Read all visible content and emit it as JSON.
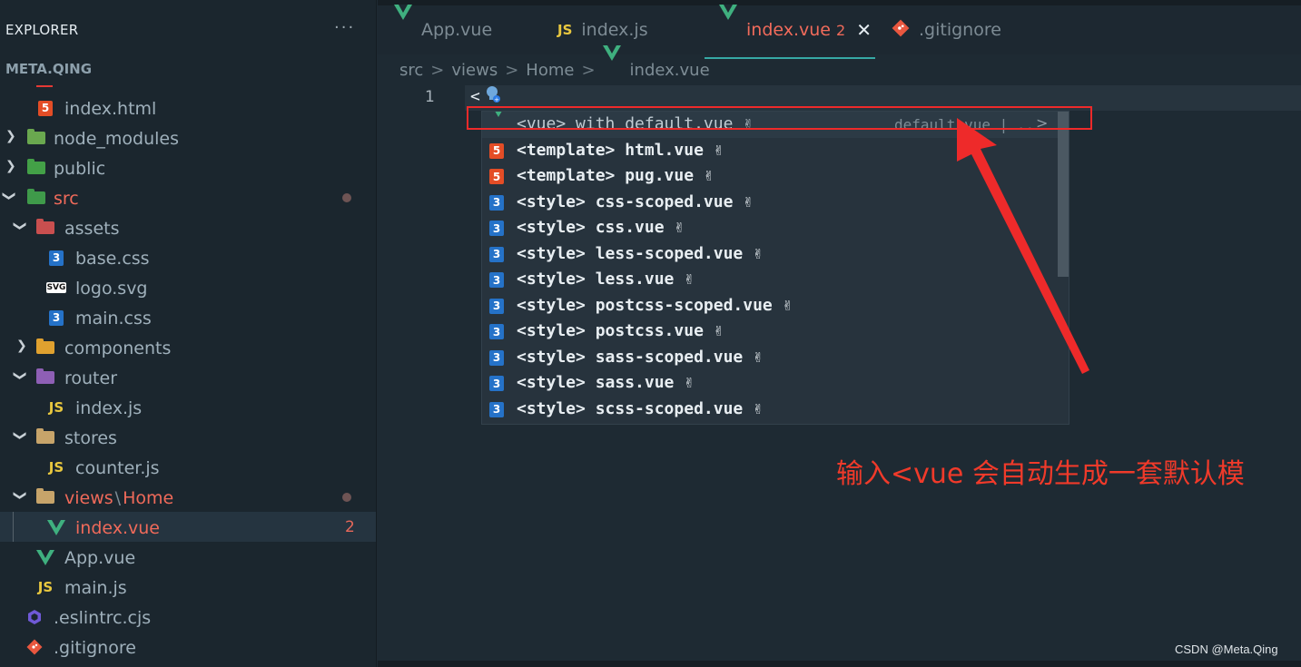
{
  "sidebar": {
    "title": "EXPLORER",
    "more": "···",
    "project": "META.QING",
    "items": [
      {
        "label": "index.html",
        "icon": "html5-icon",
        "name": "file-index-html"
      },
      {
        "label": "node_modules",
        "icon": "node-folder-icon",
        "name": "folder-node-modules"
      },
      {
        "label": "public",
        "icon": "public-folder-icon",
        "name": "folder-public"
      },
      {
        "label": "src",
        "icon": "src-folder-icon",
        "name": "folder-src"
      },
      {
        "label": "assets",
        "icon": "assets-folder-icon",
        "name": "folder-assets"
      },
      {
        "label": "base.css",
        "icon": "css3-icon",
        "name": "file-base-css"
      },
      {
        "label": "logo.svg",
        "icon": "svg-icon",
        "name": "file-logo-svg"
      },
      {
        "label": "main.css",
        "icon": "css3-icon",
        "name": "file-main-css"
      },
      {
        "label": "components",
        "icon": "components-folder-icon",
        "name": "folder-components"
      },
      {
        "label": "router",
        "icon": "router-folder-icon",
        "name": "folder-router"
      },
      {
        "label": "index.js",
        "icon": "js-icon",
        "name": "file-router-index-js"
      },
      {
        "label": "stores",
        "icon": "folder-icon",
        "name": "folder-stores"
      },
      {
        "label": "counter.js",
        "icon": "js-icon",
        "name": "file-counter-js"
      },
      {
        "label": "views",
        "icon": "folder-icon",
        "name": "folder-views-home"
      },
      {
        "label": "index.vue",
        "icon": "vue-icon",
        "name": "file-index-vue"
      },
      {
        "label": "App.vue",
        "icon": "vue-icon",
        "name": "file-app-vue"
      },
      {
        "label": "main.js",
        "icon": "js-icon",
        "name": "file-main-js"
      },
      {
        "label": ".eslintrc.cjs",
        "icon": "eslint-icon",
        "name": "file-eslintrc"
      },
      {
        "label": ".gitignore",
        "icon": "git-icon",
        "name": "file-gitignore"
      }
    ],
    "views_sep": "\\",
    "views_child": "Home",
    "index_vue_badge": "2"
  },
  "tabs": [
    {
      "label": "App.vue",
      "icon": "vue-icon"
    },
    {
      "label": "index.js",
      "icon": "js-icon"
    },
    {
      "label": "index.vue",
      "icon": "vue-icon",
      "badge": "2",
      "close": "✕"
    },
    {
      "label": ".gitignore",
      "icon": "git-icon"
    }
  ],
  "breadcrumb": [
    "src",
    "views",
    "Home",
    "index.vue"
  ],
  "breadcrumb_sep": ">",
  "editor": {
    "line_number": "1",
    "line_text": "<"
  },
  "suggestions": [
    {
      "icon": "vue-icon",
      "text": "<vue> with default.vue ✌",
      "detail": "default.vue | .."
    },
    {
      "icon": "html5-icon",
      "text": "<template> html.vue ✌"
    },
    {
      "icon": "html5-icon",
      "text": "<template> pug.vue ✌"
    },
    {
      "icon": "css3-icon",
      "text": "<style> css-scoped.vue ✌"
    },
    {
      "icon": "css3-icon",
      "text": "<style> css.vue ✌"
    },
    {
      "icon": "css3-icon",
      "text": "<style> less-scoped.vue ✌"
    },
    {
      "icon": "css3-icon",
      "text": "<style> less.vue ✌"
    },
    {
      "icon": "css3-icon",
      "text": "<style> postcss-scoped.vue ✌"
    },
    {
      "icon": "css3-icon",
      "text": "<style> postcss.vue ✌"
    },
    {
      "icon": "css3-icon",
      "text": "<style> sass-scoped.vue ✌"
    },
    {
      "icon": "css3-icon",
      "text": "<style> sass.vue ✌"
    },
    {
      "icon": "css3-icon",
      "text": "<style> scss-scoped.vue ✌"
    }
  ],
  "suggest_more": ">",
  "annotation": "输入<vue 会自动生成一套默认模",
  "watermark": "CSDN @Meta.Qing",
  "colors": {
    "accent": "#36a9a5",
    "error": "#f06a5a",
    "annotation": "#ee2a2a",
    "vue": "#3fb07f"
  }
}
